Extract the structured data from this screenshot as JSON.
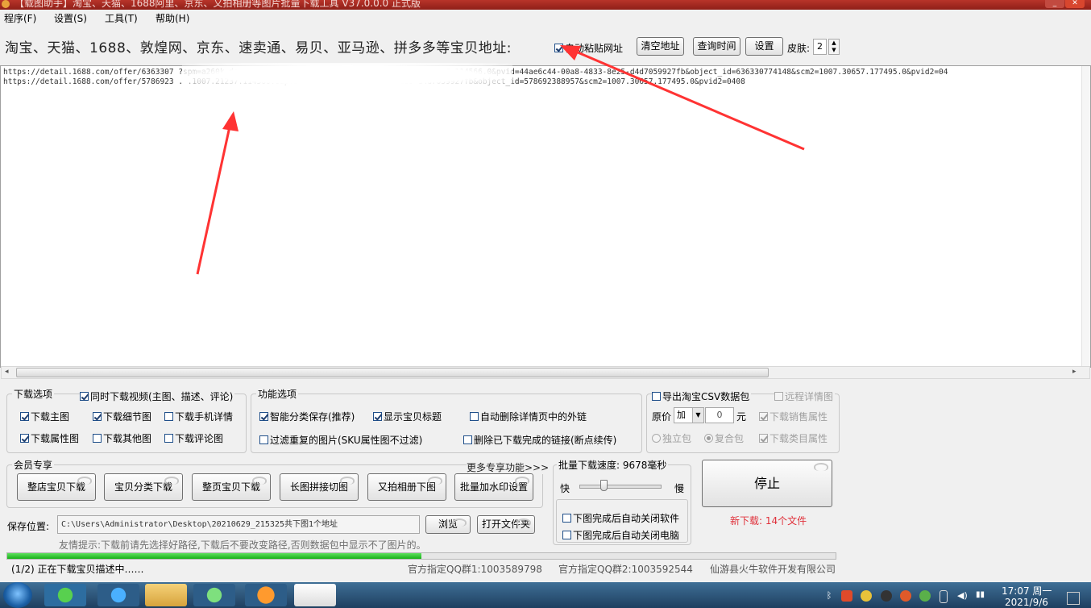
{
  "window": {
    "title": "【载图助手】淘宝、天猫、1688阿里、京东、又拍相册等图片批量下载工具 V37.0.0.0 正式版",
    "colors": {
      "titlebar": "#a32820",
      "accent_red": "#ff3333",
      "progress": "#22bb22",
      "link_red": "#e0303a"
    }
  },
  "menu": {
    "items": [
      "程序(F)",
      "设置(S)",
      "工具(T)",
      "帮助(H)"
    ]
  },
  "toolbar": {
    "heading": "淘宝、天猫、1688、敦煌网、京东、速卖通、易贝、亚马逊、拼多多等宝贝地址:",
    "auto_paste_label": "自动粘贴网址",
    "auto_paste_checked": true,
    "clear_label": "清空地址",
    "query_time_label": "查询时间",
    "settings_label": "设置",
    "skin_label": "皮肤:",
    "skin_value": "2"
  },
  "urls": [
    "https://detail.1688.com/offer/6363307         ?spm=a260k.dacugeneral.          .12.6633436c68v1wt&&...m=1007.21237.114566.0&pvid=44ae6c44-00a8-4833-8e25-d4d7059927fb&object_id=636330774148&scm2=1007.30657.177495.0&pvid2=04",
    "https://detail.1688.com/offer/5786923          .                                 .1007.21237.114566.0&pvid=44ae6c44-00a8-4833-8e25-d4d7059927fb&object_id=578692388957&scm2=1007.30657.177495.0&pvid2=0408"
  ],
  "download_options": {
    "group_label": "下载选项",
    "video_label": "同时下载视频(主图、描述、评论)",
    "video_checked": true,
    "items": [
      {
        "label": "下载主图",
        "checked": true
      },
      {
        "label": "下载细节图",
        "checked": true
      },
      {
        "label": "下载手机详情",
        "checked": false
      },
      {
        "label": "下载属性图",
        "checked": true
      },
      {
        "label": "下载其他图",
        "checked": false
      },
      {
        "label": "下载评论图",
        "checked": false
      }
    ]
  },
  "function_options": {
    "group_label": "功能选项",
    "items": [
      {
        "label": "智能分类保存(推荐)",
        "checked": true
      },
      {
        "label": "显示宝贝标题",
        "checked": true
      },
      {
        "label": "自动删除详情页中的外链",
        "checked": false
      },
      {
        "label": "过滤重复的图片(SKU属性图不过滤)",
        "checked": false
      },
      {
        "label": "删除已下载完成的链接(断点续传)",
        "checked": false
      }
    ]
  },
  "csv": {
    "export_label": "导出淘宝CSV数据包",
    "export_checked": false,
    "remote_label": "远程详情图",
    "remote_checked": false,
    "price_label": "原价",
    "price_op": "加",
    "price_value": "0",
    "price_unit": "元",
    "sales_attr_label": "下载销售属性",
    "sales_attr_checked": true,
    "single_pkg_label": "独立包",
    "merged_pkg_label": "复合包",
    "category_attr_label": "下载类目属性",
    "category_attr_checked": true
  },
  "member": {
    "group_label": "会员专享",
    "more_label": "更多专享功能>>>",
    "buttons": [
      "整店宝贝下载",
      "宝贝分类下载",
      "整页宝贝下载",
      "长图拼接切图",
      "又拍相册下图",
      "批量加水印设置"
    ]
  },
  "speed": {
    "label": "批量下载速度: 9678毫秒",
    "fast_label": "快",
    "slow_label": "慢",
    "slider_fraction": 0.3,
    "close_app_label": "下图完成后自动关闭软件",
    "shutdown_label": "下图完成后自动关闭电脑"
  },
  "stop": {
    "label": "停止",
    "new_download_text": "新下载: 14个文件"
  },
  "save": {
    "label": "保存位置:",
    "path": "C:\\Users\\Administrator\\Desktop\\20210629_215325共下图1个地址",
    "browse_label": "浏览",
    "open_folder_label": "打开文件夹",
    "hint": "友情提示:下载前请先选择好路径,下载后不要改变路径,否则数据包中显示不了图片的。"
  },
  "status": {
    "progress_fraction": 0.5,
    "message": "(1/2) 正在下载宝贝描述中……",
    "qq1": "官方指定QQ群1:1003589798",
    "qq2": "官方指定QQ群2:1003592544",
    "company": "仙游县火牛软件开发有限公司"
  },
  "taskbar": {
    "time": "17:07 周一",
    "date": "2021/9/6"
  }
}
